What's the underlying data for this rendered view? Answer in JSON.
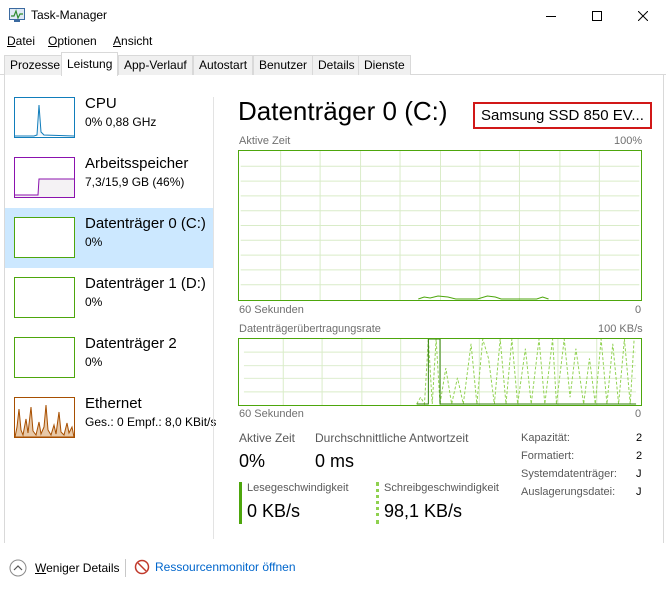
{
  "window": {
    "title": "Task-Manager"
  },
  "menu": [
    {
      "label": "Datei",
      "underline": "D",
      "rest": "atei"
    },
    {
      "label": "Optionen",
      "underline": "O",
      "rest": "ptionen"
    },
    {
      "label": "Ansicht",
      "underline": "A",
      "rest": "nsicht"
    }
  ],
  "tabs": [
    "Prozesse",
    "Leistung",
    "App-Verlauf",
    "Autostart",
    "Benutzer",
    "Details",
    "Dienste"
  ],
  "active_tab": "Leistung",
  "sidebar": {
    "items": [
      {
        "label": "CPU",
        "sub": "0% 0,88 GHz",
        "color": "#117dbb"
      },
      {
        "label": "Arbeitsspeicher",
        "sub": "7,3/15,9 GB (46%)",
        "color": "#8b12ae"
      },
      {
        "label": "Datenträger 0 (C:)",
        "sub": "0%",
        "color": "#4da60c",
        "selected": true
      },
      {
        "label": "Datenträger 1 (D:)",
        "sub": "0%",
        "color": "#4da60c"
      },
      {
        "label": "Datenträger 2",
        "sub": "0%",
        "color": "#4da60c"
      },
      {
        "label": "Ethernet",
        "sub": "Ges.: 0 Empf.: 8,0 KBit/s",
        "color": "#a74f01"
      }
    ]
  },
  "main": {
    "title": "Datenträger 0 (C:)",
    "model": "Samsung SSD 850 EV...",
    "graph1": {
      "label": "Aktive Zeit",
      "max": "100%",
      "time": "60 Sekunden",
      "min": "0"
    },
    "graph2": {
      "label": "Datenträgerübertragungsrate",
      "max": "100 KB/s",
      "time": "60 Sekunden",
      "min": "0"
    },
    "stats": {
      "active_time_label": "Aktive Zeit",
      "active_time_value": "0%",
      "response_label": "Durchschnittliche Antwortzeit",
      "response_value": "0 ms",
      "read_label": "Lesegeschwindigkeit",
      "read_value": "0 KB/s",
      "write_label": "Schreibgeschwindigkeit",
      "write_value": "98,1 KB/s"
    },
    "properties": [
      {
        "label": "Kapazität:",
        "value": "2"
      },
      {
        "label": "Formatiert:",
        "value": "2"
      },
      {
        "label": "Systemdatenträger:",
        "value": "J"
      },
      {
        "label": "Auslagerungsdatei:",
        "value": "J"
      }
    ]
  },
  "footer": {
    "fewer_details": "Weniger Details",
    "fewer_details_underline": "W",
    "fewer_details_rest": "eniger Details",
    "resource_monitor": "Ressourcenmonitor öffnen"
  },
  "colors": {
    "disk": "#4da60c",
    "disk_light": "#8fd14f",
    "selected_bg": "#cce8ff",
    "model_border": "#d11818",
    "link": "#0066cc"
  }
}
